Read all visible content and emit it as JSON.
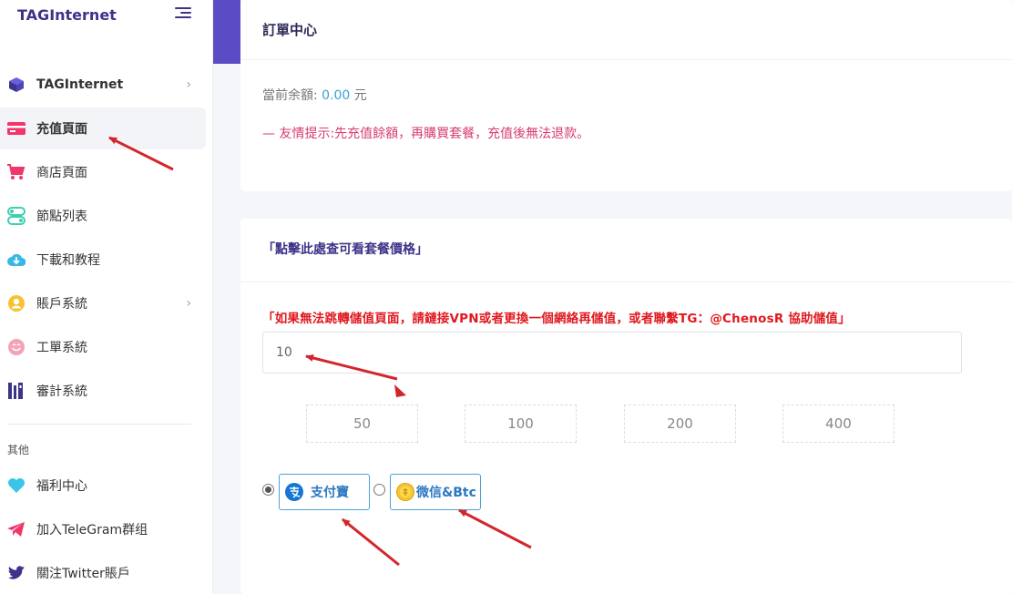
{
  "brand": "TAGInternet",
  "sidebar": {
    "items": [
      {
        "label": "TAGInternet",
        "icon": "cube-icon",
        "has_chevron": true
      },
      {
        "label": "充值頁面",
        "icon": "card-icon",
        "active": true
      },
      {
        "label": "商店頁面",
        "icon": "cart-icon"
      },
      {
        "label": "節點列表",
        "icon": "nodes-icon"
      },
      {
        "label": "下載和教程",
        "icon": "cloud-download-icon"
      },
      {
        "label": "賬戶系統",
        "icon": "account-icon",
        "has_chevron": true
      },
      {
        "label": "工單系統",
        "icon": "smile-icon"
      },
      {
        "label": "審計系統",
        "icon": "audit-icon"
      },
      {
        "label": "福利中心",
        "icon": "heart-icon"
      },
      {
        "label": "加入TeleGram群组",
        "icon": "telegram-icon"
      },
      {
        "label": "關注Twitter賬戶",
        "icon": "twitter-icon"
      }
    ],
    "section_other": "其他",
    "chevron": "›"
  },
  "order_card": {
    "title": "訂單中心",
    "balance_label": "當前余額:",
    "balance_value": "0.00",
    "balance_unit": "元",
    "tip": "— 友情提示:先充值餘額，再購買套餐，充值後無法退款。"
  },
  "topup_card": {
    "header": "「點擊此處查可看套餐價格」",
    "warning": "「如果無法跳轉儲值頁面，請鏈接VPN或者更換一個網絡再儲值，或者聯繫TG：@ChenosR 協助儲值」",
    "amount_value": "10",
    "presets": [
      "50",
      "100",
      "200",
      "400"
    ],
    "payment_methods": [
      {
        "label": "支付寶",
        "icon": "alipay-icon",
        "selected": true
      },
      {
        "label": "微信&Btc",
        "icon": "coin-icon",
        "selected": false
      }
    ]
  },
  "colors": {
    "brand": "#3d3489",
    "accent": "#5b4bc4",
    "warning": "#e0191f",
    "tip": "#d63b6f",
    "annotation": "#d4252b"
  }
}
